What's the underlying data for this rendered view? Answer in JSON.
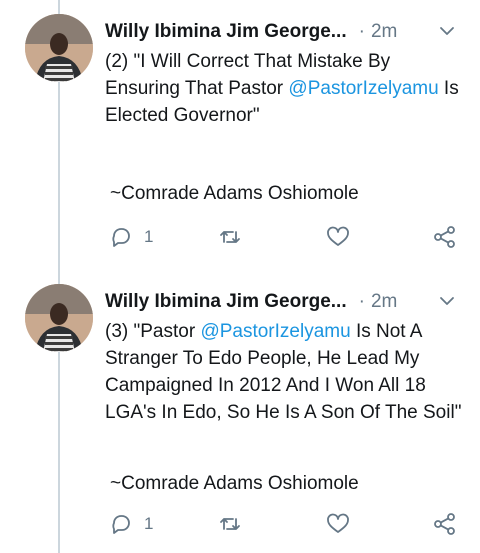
{
  "tweets": [
    {
      "author": "Willy Ibimina Jim George...",
      "separator": "·",
      "time": "2m",
      "text_pre": "(2) \"I Will Correct That Mistake By Ensuring That Pastor ",
      "mention": "@PastorIzelyamu",
      "text_post": " Is Elected Governor\"",
      "signature": "~Comrade Adams Oshiomole",
      "reply_count": "1",
      "icons": [
        "reply-icon",
        "retweet-icon",
        "like-icon",
        "share-icon",
        "chevron-down-icon"
      ]
    },
    {
      "author": "Willy Ibimina Jim George...",
      "separator": "·",
      "time": "2m",
      "text_pre": "(3) \"Pastor ",
      "mention": "@PastorIzelyamu",
      "text_post": " Is Not A Stranger To Edo People, He Lead My Campaigned In 2012 And I Won All 18 LGA's In Edo, So He Is A Son Of The Soil\"",
      "signature": "~Comrade Adams Oshiomole",
      "reply_count": "1",
      "icons": [
        "reply-icon",
        "retweet-icon",
        "like-icon",
        "share-icon",
        "chevron-down-icon"
      ]
    }
  ],
  "colors": {
    "text": "#14171a",
    "secondary": "#657786",
    "mention": "#1b95e0",
    "thread_line": "#ccd6dd"
  }
}
